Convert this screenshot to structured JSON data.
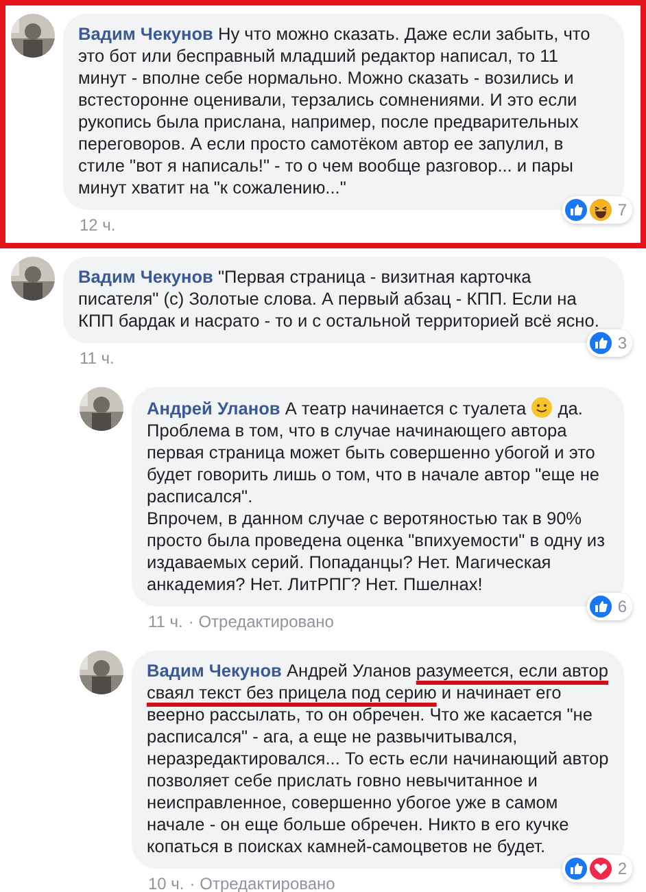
{
  "comments": [
    {
      "author": "Вадим Чекунов",
      "reply": false,
      "highlighted": true,
      "paragraphs": [
        [
          {
            "kind": "text",
            "text": "Ну что можно сказать. Даже если забыть, что это бот или бесправный младший редактор написал, то 11 минут - вполне себе нормально. Можно сказать - возились и встесторонне оценивали, терзались сомнениями. И это если рукопись была прислана, например, после предварительных переговоров. А если просто самотёком автор ее запулил, в стиле \"вот я написаль!\" - то о чем вообще разговор... и пары минут хватит на \"к сожалению...\"",
            "underlined": false
          }
        ]
      ],
      "time": "12 ч.",
      "reactions": {
        "kinds": [
          {
            "kind": "like"
          },
          {
            "kind": "haha"
          }
        ],
        "count": "7"
      }
    },
    {
      "author": "Вадим Чекунов",
      "reply": false,
      "highlighted": false,
      "paragraphs": [
        [
          {
            "kind": "text",
            "text": "\"Первая страница - визитная карточка писателя\" (с) Золотые слова. А первый абзац - КПП. Если на КПП бардак и насрато - то и с остальной территорией всё ясно.",
            "underlined": false
          }
        ]
      ],
      "time": "11 ч.",
      "reactions": {
        "kinds": [
          {
            "kind": "like"
          }
        ],
        "count": "3"
      }
    },
    {
      "author": "Андрей Уланов",
      "reply": true,
      "highlighted": false,
      "paragraphs": [
        [
          {
            "kind": "text",
            "text": "А театр начинается с туалета ",
            "underlined": false
          },
          {
            "kind": "emoji"
          },
          {
            "kind": "text",
            "text": " да.",
            "underlined": false
          }
        ],
        [
          {
            "kind": "text",
            "text": "Проблема в том, что в случае начинающего автора первая страница может быть совершенно убогой и это будет говорить лишь о том, что в начале автор \"еще не расписался\".",
            "underlined": false
          }
        ],
        [
          {
            "kind": "text",
            "text": "Впрочем, в данном случае с веротяностью так в 90% просто была проведена оценка \"впихуемости\" в одну из издаваемых серий. Попаданцы? Нет. Магическая анкадемия? Нет. ЛитРПГ? Нет. Пшелнах!",
            "underlined": false
          }
        ]
      ],
      "time": "11 ч.",
      "edited": "· Отредактировано",
      "reactions": {
        "kinds": [
          {
            "kind": "like"
          }
        ],
        "count": "6"
      }
    },
    {
      "author": "Вадим Чекунов",
      "reply": true,
      "highlighted": false,
      "paragraphs": [
        [
          {
            "kind": "text",
            "text": "Андрей Уланов ",
            "underlined": false
          },
          {
            "kind": "text",
            "text": "разумеется, если автор сваял текст без прицела под серию",
            "underlined": true
          },
          {
            "kind": "text",
            "text": " и начинает его веерно рассылать, то он обречен. Что же касается \"не расписался\" - ага, а еще не развычитывался, неразредактировался... То есть если начинающий автор позволяет себе прислать говно невычитанное и неисправленное, совершенно убогое уже в самом начале - он еще больше обречен. Никто в его кучке копаться в поисках камней-самоцветов не будет.",
            "underlined": false
          }
        ]
      ],
      "time": "10 ч.",
      "edited": "· Отредактировано",
      "reactions": {
        "kinds": [
          {
            "kind": "like"
          },
          {
            "kind": "love"
          }
        ],
        "count": "2"
      }
    }
  ]
}
